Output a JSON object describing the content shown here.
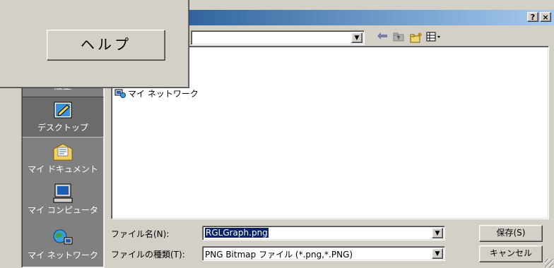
{
  "titlebar": {
    "help_btn": "?",
    "close_btn": "×"
  },
  "lookin": {
    "value": ""
  },
  "places": [
    {
      "label": "履歴",
      "icon": "history-icon"
    },
    {
      "label": "デスクトップ",
      "icon": "desktop-icon",
      "selected": true
    },
    {
      "label": "マイ ドキュメント",
      "icon": "my-documents-icon"
    },
    {
      "label": "マイ コンピュータ",
      "icon": "my-computer-icon"
    },
    {
      "label": "マイ ネットワーク",
      "icon": "my-network-icon"
    }
  ],
  "filelist": {
    "item_label": "マイ ネットワーク"
  },
  "filename": {
    "label": "ファイル名(N):",
    "value": "RGLGraph.png"
  },
  "filetype": {
    "label": "ファイルの種類(T):",
    "value": "PNG Bitmap ファイル (*.png,*.PNG)"
  },
  "buttons": {
    "save": "保存(S)",
    "cancel": "キャンセル"
  },
  "popup": {
    "help_label": "ヘルプ"
  },
  "colors": {
    "face": "#d4d0c8",
    "title_start": "#0a246a",
    "title_end": "#a6caf0",
    "selection": "#0a246a"
  }
}
